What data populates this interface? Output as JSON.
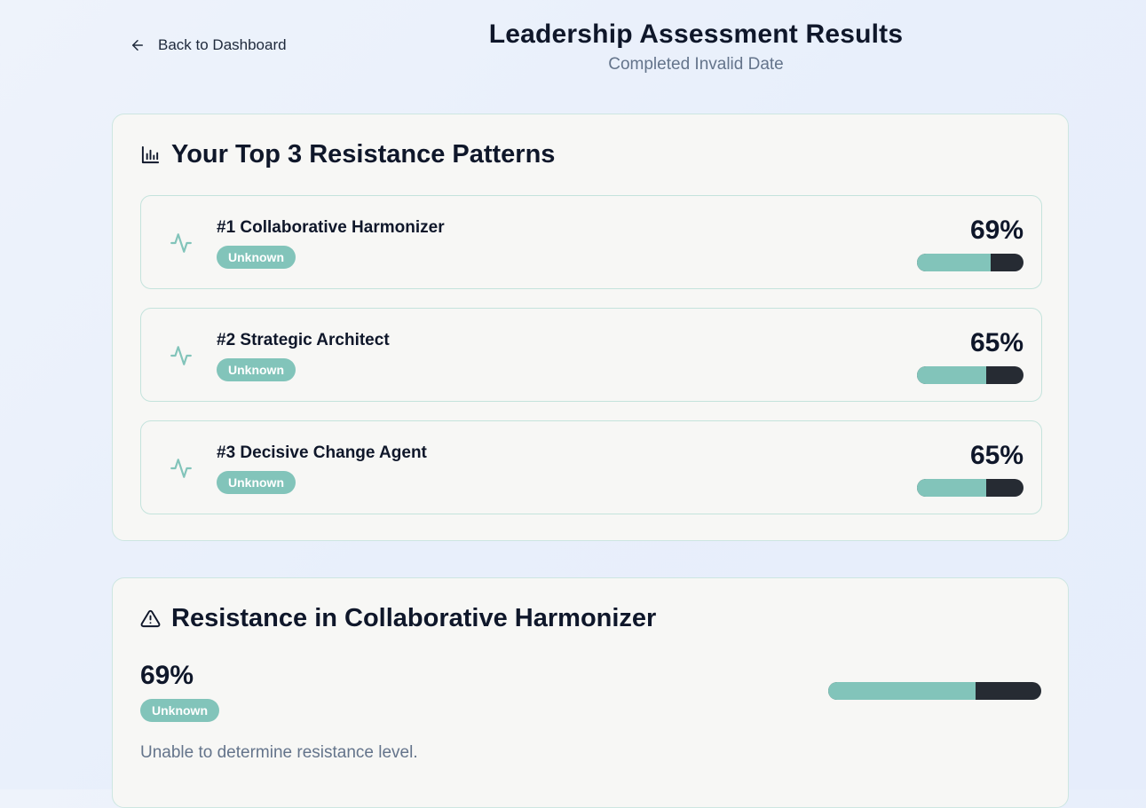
{
  "nav": {
    "back_label": "Back to Dashboard"
  },
  "header": {
    "title": "Leadership Assessment Results",
    "subtitle": "Completed Invalid Date"
  },
  "top_patterns": {
    "title": "Your Top 3 Resistance Patterns",
    "items": [
      {
        "label": "#1 Collaborative Harmonizer",
        "badge": "Unknown",
        "percent_label": "69%",
        "percent": 69
      },
      {
        "label": "#2 Strategic Architect",
        "badge": "Unknown",
        "percent_label": "65%",
        "percent": 65
      },
      {
        "label": "#3 Decisive Change Agent",
        "badge": "Unknown",
        "percent_label": "65%",
        "percent": 65
      }
    ]
  },
  "resistance_detail": {
    "title": "Resistance in Collaborative Harmonizer",
    "percent_label": "69%",
    "percent": 69,
    "badge": "Unknown",
    "description": "Unable to determine resistance level."
  },
  "colors": {
    "accent": "#82c4ba",
    "bar_track": "#262b33",
    "card_bg": "#f7f7f5",
    "card_border": "#cde6e1"
  },
  "icons": {
    "back": "arrow-left-icon",
    "chart": "bar-chart-icon",
    "pulse": "activity-icon",
    "warning": "alert-triangle-icon"
  }
}
